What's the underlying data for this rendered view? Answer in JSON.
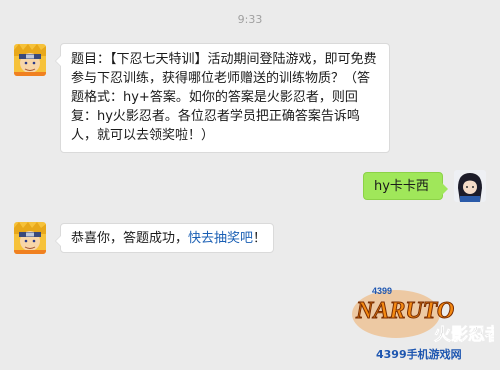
{
  "chat": {
    "timestamp": "9:33",
    "messages": [
      {
        "side": "left",
        "text": "题目：【下忍七天特训】活动期间登陆游戏，即可免费参与下忍训练，获得哪位老师赠送的训练物质？（答题格式：hy+答案。如你的答案是火影忍者，则回复：hy火影忍者。各位忍者学员把正确答案告诉鸣人，就可以去领奖啦！）"
      },
      {
        "side": "right",
        "text": "hy卡卡西"
      },
      {
        "side": "left",
        "text_prefix": "恭喜你，答题成功，",
        "link_text": "快去抽奖吧",
        "text_suffix": "！"
      }
    ]
  },
  "watermark": {
    "number": "4399",
    "brand": "NARUTO",
    "title": "火影忍者",
    "site": "4399手机游戏网"
  },
  "colors": {
    "background": "#ebebeb",
    "sent_bubble": "#a0e75a",
    "received_bubble": "#ffffff",
    "link": "#1a5fb4"
  }
}
